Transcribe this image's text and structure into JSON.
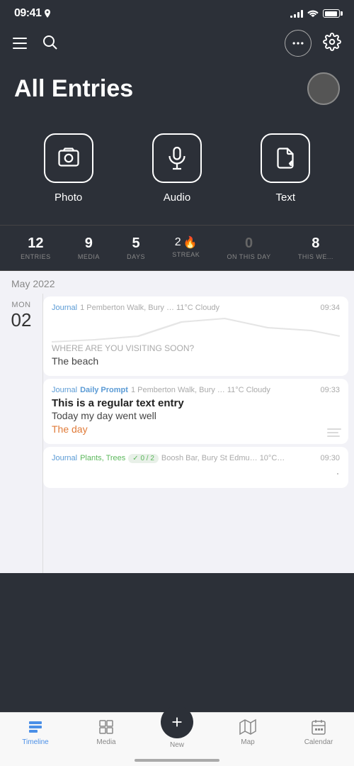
{
  "statusBar": {
    "time": "09:41",
    "hasLocation": true
  },
  "header": {
    "title": "All Entries",
    "menuLabel": "menu",
    "searchLabel": "search",
    "moreLabel": "more options",
    "settingsLabel": "settings"
  },
  "quickActions": [
    {
      "id": "photo",
      "label": "Photo"
    },
    {
      "id": "audio",
      "label": "Audio"
    },
    {
      "id": "text",
      "label": "Text"
    }
  ],
  "stats": [
    {
      "id": "entries",
      "value": "12",
      "label": "ENTRIES"
    },
    {
      "id": "media",
      "value": "9",
      "label": "MEDIA"
    },
    {
      "id": "days",
      "value": "5",
      "label": "DAYS"
    },
    {
      "id": "streak",
      "value": "2",
      "label": "STREAK",
      "hasFlame": true
    },
    {
      "id": "on_this_day",
      "value": "0",
      "label": "ON THIS DAY",
      "muted": true
    },
    {
      "id": "this_week",
      "value": "8",
      "label": "THIS WE..."
    }
  ],
  "monthHeader": "May 2022",
  "dateGroup": {
    "dayName": "MON",
    "dayNum": "02"
  },
  "entries": [
    {
      "id": "entry1",
      "journalLabel": "Journal",
      "journalColor": "default",
      "meta": "1 Pemberton Walk, Bury … 11°C Cloudy",
      "time": "09:34",
      "hasGraph": true,
      "promptText": "WHERE ARE YOU VISITING SOON?",
      "bodyText": "The beach",
      "hasWeatherIcon": true
    },
    {
      "id": "entry2",
      "journalLabel": "Journal",
      "journalColor": "default",
      "promptLabel": "Daily Prompt",
      "meta": "1 Pemberton Walk, Bury … 11°C Cloudy",
      "time": "09:33",
      "titleText": "This is a regular text entry",
      "bodyLine1": "Today my day went well",
      "bodyLine2": "The day",
      "bodyLine2Color": "highlight",
      "hasLinesIcon": true
    },
    {
      "id": "entry3",
      "journalLabel": "Journal",
      "journalColor": "default",
      "tagsLabel": "Plants, Trees",
      "tagBadge": "✓ 0 / 2",
      "meta": "Boosh Bar, Bury St Edmu… 10°C…",
      "time": "09:30",
      "hasDot": true
    }
  ],
  "tabBar": {
    "tabs": [
      {
        "id": "timeline",
        "label": "Timeline",
        "active": true
      },
      {
        "id": "media",
        "label": "Media",
        "active": false
      },
      {
        "id": "new",
        "label": "New",
        "isNew": true
      },
      {
        "id": "map",
        "label": "Map",
        "active": false
      },
      {
        "id": "calendar",
        "label": "Calendar",
        "active": false
      }
    ]
  }
}
